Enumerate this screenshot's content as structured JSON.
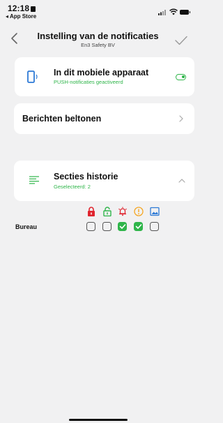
{
  "status_bar": {
    "time": "12:18",
    "back_app": "◂ App Store",
    "icons": [
      "signal-icon",
      "wifi-icon",
      "battery-icon"
    ]
  },
  "nav": {
    "title": "Instelling van de notificaties",
    "subtitle": "En3 Safety BV"
  },
  "device_card": {
    "title": "In dit mobiele apparaat",
    "subtitle": "PUSH-notificaties geactiveerd",
    "toggle_on": true
  },
  "ringtones": {
    "label": "Berichten beltonen"
  },
  "history": {
    "title": "Secties historie",
    "subtitle": "Geselecteerd: 2",
    "expanded": true
  },
  "grid": {
    "categories": [
      "lock-closed-icon",
      "lock-open-icon",
      "alarm-bell-icon",
      "warning-circle-icon",
      "image-icon"
    ],
    "rows": [
      {
        "label": "Bureau",
        "checked": [
          false,
          false,
          true,
          true,
          false
        ]
      }
    ]
  },
  "colors": {
    "accent_green": "#2fb54a",
    "red": "#e0252f",
    "orange": "#f5a623",
    "blue": "#2d7ad6",
    "background": "#f1f1f2"
  }
}
